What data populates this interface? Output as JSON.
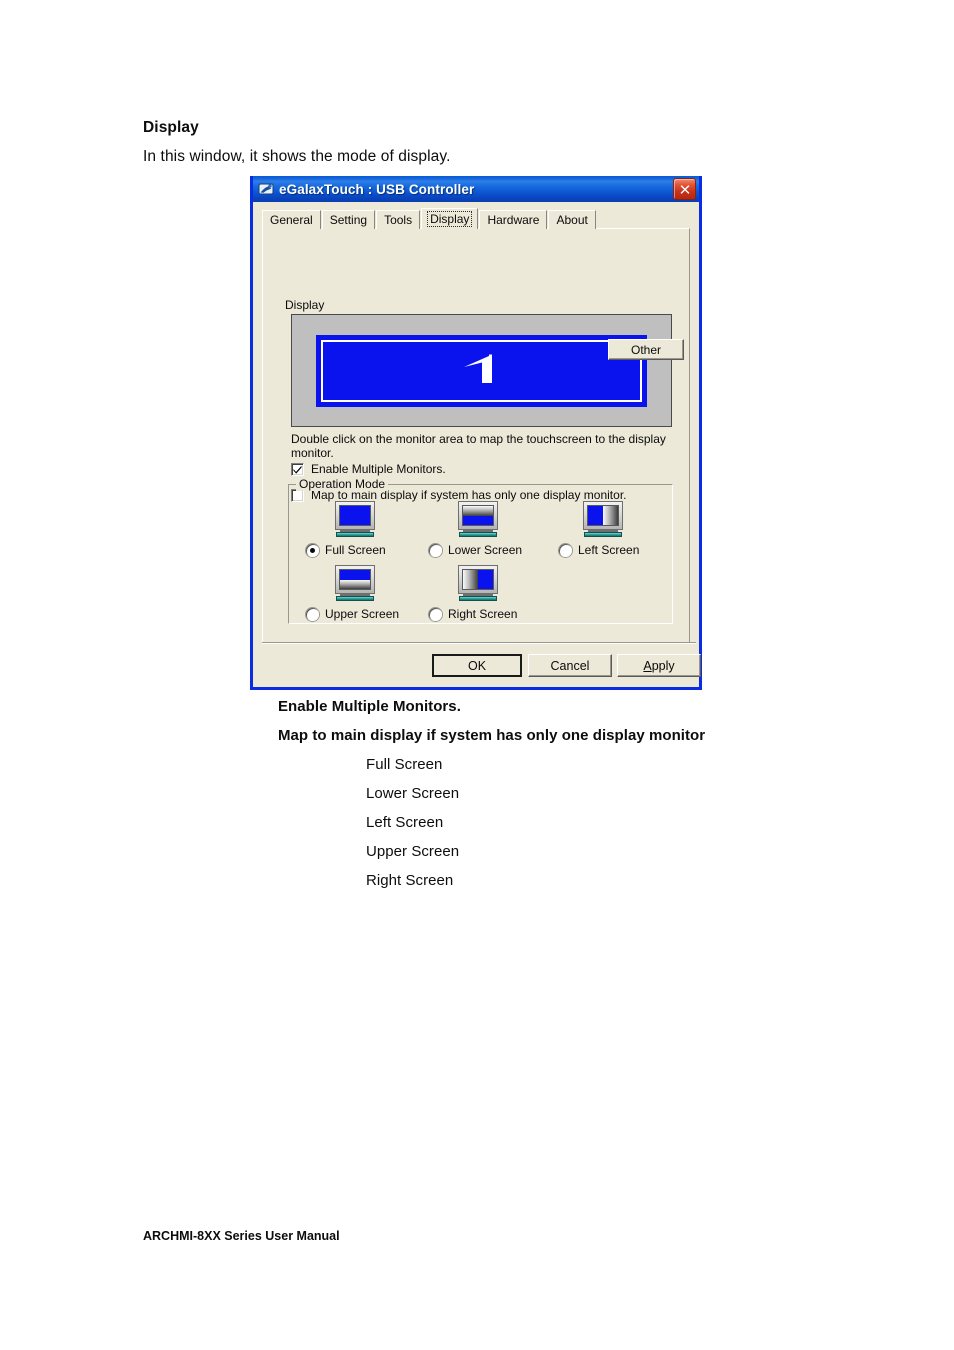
{
  "document": {
    "heading": "Display",
    "intro": "In this window, it shows the mode of display.",
    "notes": [
      "Enable Multiple Monitors.",
      "Map to main display if system has only one display monitor"
    ],
    "mode_list": [
      "Full Screen",
      "Lower Screen",
      "Left Screen",
      "Upper Screen",
      "Right Screen"
    ],
    "footer": "ARCHMI-8XX Series User Manual"
  },
  "window": {
    "title": "eGalaxTouch : USB Controller",
    "close_label": "Close",
    "titlebar_color": "#0a5bd3",
    "face_color": "#ece9d8",
    "tabs": [
      {
        "label": "General",
        "selected": false
      },
      {
        "label": "Setting",
        "selected": false
      },
      {
        "label": "Tools",
        "selected": false
      },
      {
        "label": "Display",
        "selected": true
      },
      {
        "label": "Hardware",
        "selected": false
      },
      {
        "label": "About",
        "selected": false
      }
    ],
    "display_group": {
      "label": "Display",
      "monitor_number": "1",
      "monitor_color": "#0a13ee",
      "panel_color": "#bfbfbf"
    },
    "hint": "Double click on the monitor area to map the touchscreen to the display monitor.",
    "checkboxes": [
      {
        "label": "Enable Multiple Monitors.",
        "checked": true
      },
      {
        "label": "Map to main display if system has only one display monitor.",
        "checked": false
      }
    ],
    "operation_mode": {
      "label": "Operation Mode",
      "options": [
        {
          "label": "Full Screen",
          "selected": true,
          "icon": "monitor-full-icon"
        },
        {
          "label": "Lower Screen",
          "selected": false,
          "icon": "monitor-lower-icon"
        },
        {
          "label": "Left Screen",
          "selected": false,
          "icon": "monitor-left-icon"
        },
        {
          "label": "Upper Screen",
          "selected": false,
          "icon": "monitor-upper-icon"
        },
        {
          "label": "Right Screen",
          "selected": false,
          "icon": "monitor-right-icon"
        }
      ],
      "other_button": "Other"
    },
    "buttons": {
      "ok": "OK",
      "cancel": "Cancel",
      "apply_prefix": "A",
      "apply_rest": "pply"
    }
  }
}
